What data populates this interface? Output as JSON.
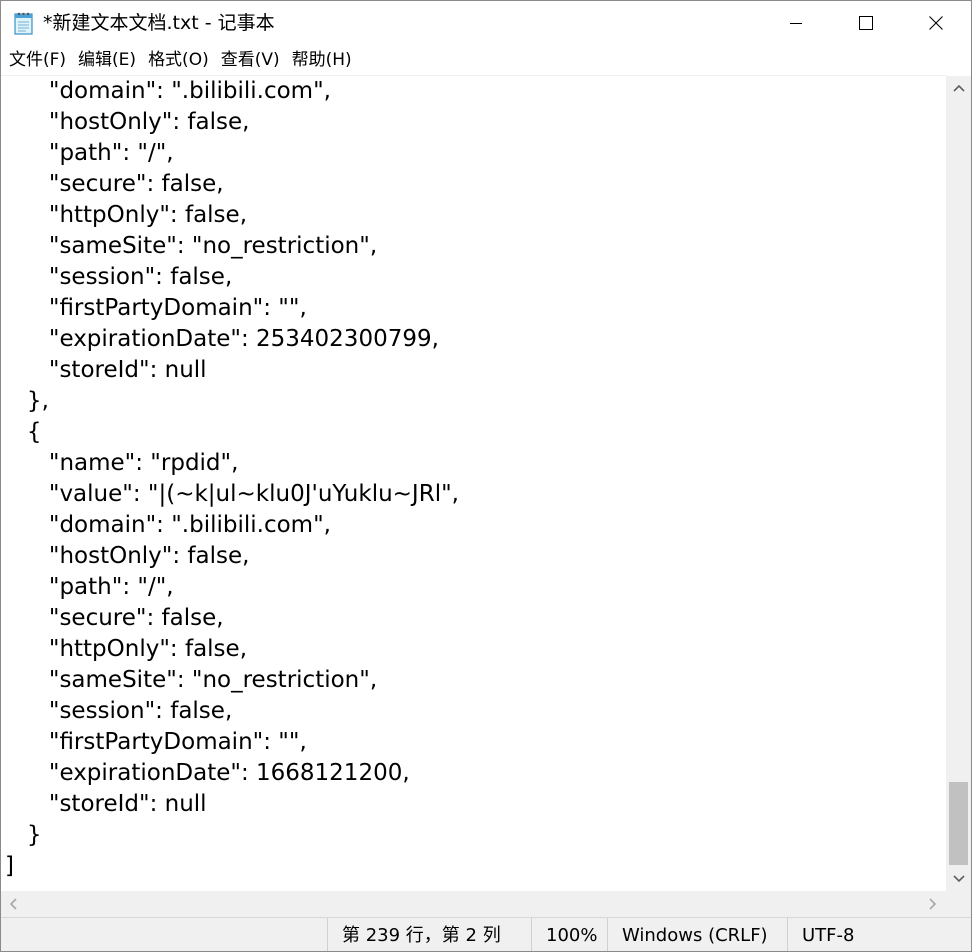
{
  "window": {
    "title": "*新建文本文档.txt - 记事本",
    "icon": "notepad-icon",
    "controls": {
      "minimize_icon": "minimize-icon",
      "maximize_icon": "maximize-icon",
      "close_icon": "close-icon"
    }
  },
  "menu": {
    "items": [
      {
        "label": "文件(F)"
      },
      {
        "label": "编辑(E)"
      },
      {
        "label": "格式(O)"
      },
      {
        "label": "查看(V)"
      },
      {
        "label": "帮助(H)"
      }
    ]
  },
  "editor": {
    "lines": [
      "      \"domain\": \".bilibili.com\",",
      "      \"hostOnly\": false,",
      "      \"path\": \"/\",",
      "      \"secure\": false,",
      "      \"httpOnly\": false,",
      "      \"sameSite\": \"no_restriction\",",
      "      \"session\": false,",
      "      \"firstPartyDomain\": \"\",",
      "      \"expirationDate\": 253402300799,",
      "      \"storeId\": null",
      "   },",
      "   {",
      "      \"name\": \"rpdid\",",
      "      \"value\": \"|(~k|ul~klu0J'uYuklu~JRl\",",
      "      \"domain\": \".bilibili.com\",",
      "      \"hostOnly\": false,",
      "      \"path\": \"/\",",
      "      \"secure\": false,",
      "      \"httpOnly\": false,",
      "      \"sameSite\": \"no_restriction\",",
      "      \"session\": false,",
      "      \"firstPartyDomain\": \"\",",
      "      \"expirationDate\": 1668121200,",
      "      \"storeId\": null",
      "   }",
      "]"
    ]
  },
  "scrollbars": {
    "vertical_position": 0.97,
    "up_icon": "chevron-up-icon",
    "down_icon": "chevron-down-icon",
    "left_icon": "chevron-left-icon",
    "right_icon": "chevron-right-icon"
  },
  "status": {
    "position": "第 239 行，第 2 列",
    "zoom": "100%",
    "line_ending": "Windows (CRLF)",
    "encoding": "UTF-8"
  }
}
